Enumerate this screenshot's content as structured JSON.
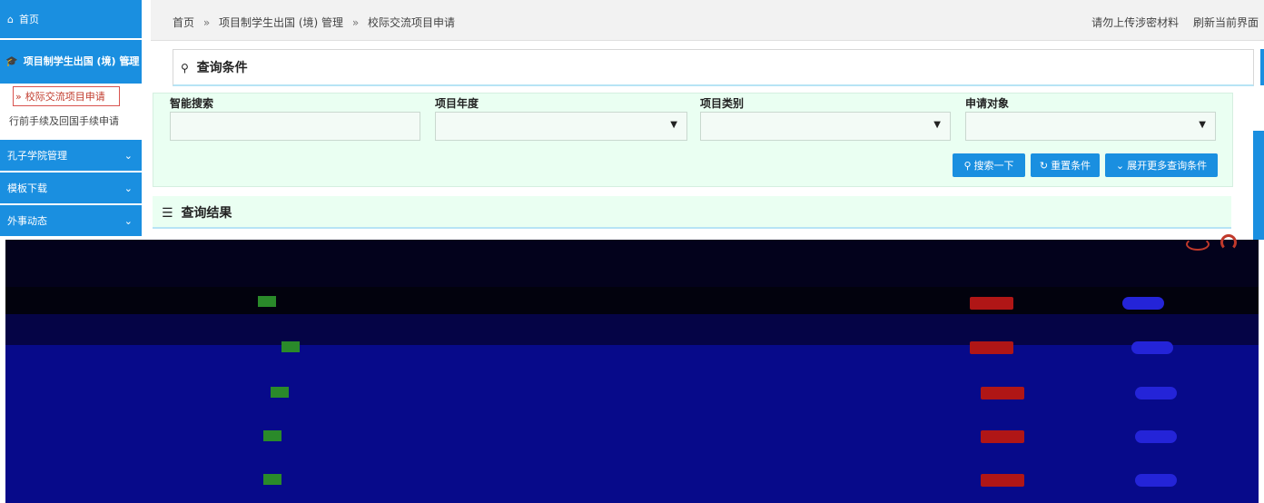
{
  "sidebar": {
    "home": "首页",
    "project": "项目制学生出国 (境) 管理",
    "children": [
      "校际交流项目申请",
      "行前手续及回国手续申请"
    ],
    "menus": [
      "孔子学院管理",
      "模板下载",
      "外事动态"
    ]
  },
  "breadcrumb": [
    "首页",
    "项目制学生出国 (境) 管理",
    "校际交流项目申请"
  ],
  "breadcrumb_sep": "»",
  "header_links": [
    "请勿上传涉密材料",
    "刷新当前界面"
  ],
  "query": {
    "title": "查询条件",
    "labels": [
      "智能搜索",
      "项目年度",
      "项目类别",
      "申请对象"
    ],
    "buttons": [
      "搜索一下",
      "重置条件",
      "展开更多查询条件"
    ]
  },
  "results": {
    "title": "查询结果"
  },
  "colors": {
    "primary": "#1a8fe0",
    "panel": "#eafff2",
    "dark": "#070a8a"
  }
}
